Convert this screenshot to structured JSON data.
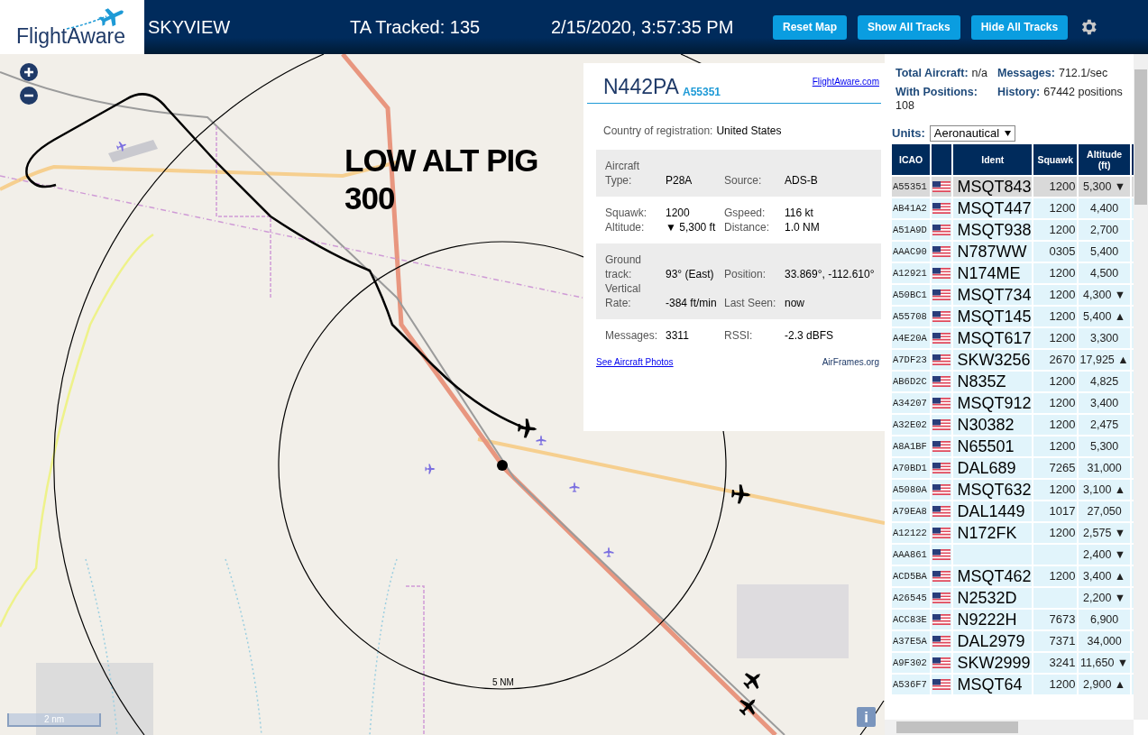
{
  "header": {
    "logo": "FlightAware",
    "title": "SKYVIEW",
    "tracked": "TA Tracked: 135",
    "datetime": "2/15/2020, 3:57:35 PM",
    "buttons": [
      "Reset Map",
      "Show All Tracks",
      "Hide All Tracks"
    ]
  },
  "map": {
    "annotation": "LOW ALT PIG\n300",
    "range_label": "5 NM",
    "scale_label": "2 nm",
    "info_button": "i"
  },
  "popup": {
    "registration": "N442PA",
    "icao": "A55351",
    "site_link": "FlightAware.com",
    "country_label": "Country of registration:",
    "country": "United States",
    "sections": [
      {
        "shaded": true,
        "fields": [
          {
            "label": "Aircraft Type:",
            "value": "P28A"
          },
          {
            "label": "Source:",
            "value": "ADS-B"
          }
        ]
      },
      {
        "shaded": false,
        "fields": [
          {
            "label": "Squawk:",
            "value": "1200"
          },
          {
            "label": "Gspeed:",
            "value": "116 kt"
          },
          {
            "label": "Altitude:",
            "value": "▼ 5,300 ft"
          },
          {
            "label": "Distance:",
            "value": "1.0 NM"
          }
        ]
      },
      {
        "shaded": true,
        "fields": [
          {
            "label": "Ground track:",
            "value": "93° (East)"
          },
          {
            "label": "Position:",
            "value": "33.869°, -112.610°"
          },
          {
            "label": "Vertical Rate:",
            "value": "-384 ft/min"
          },
          {
            "label": "Last Seen:",
            "value": "now"
          }
        ]
      },
      {
        "shaded": false,
        "fields": [
          {
            "label": "Messages:",
            "value": "3311"
          },
          {
            "label": "RSSI:",
            "value": "-2.3 dBFS"
          }
        ]
      }
    ],
    "photos_link": "See Aircraft Photos",
    "airframes_link": "AirFrames.org"
  },
  "stats": [
    {
      "label": "Total Aircraft:",
      "value": "n/a"
    },
    {
      "label": "Messages:",
      "value": "712.1/sec"
    },
    {
      "label": "With Positions:",
      "value": "108"
    },
    {
      "label": "History:",
      "value": "67442 positions"
    }
  ],
  "units": {
    "label": "Units:",
    "value": "Aeronautical"
  },
  "table": {
    "columns": [
      {
        "kind": "text",
        "label": "ICAO"
      },
      {
        "kind": "flag"
      },
      {
        "kind": "text",
        "label": "Ident"
      },
      {
        "kind": "text",
        "label": "Squawk"
      },
      {
        "kind": "text",
        "label": "Altitude (ft)"
      },
      {
        "kind": "cut"
      }
    ],
    "rows": [
      {
        "icao": "A55351",
        "ident": "MSQT843",
        "squawk": "1200",
        "altitude": "5,300 ▼",
        "selected": true
      },
      {
        "icao": "AB41A2",
        "ident": "MSQT447",
        "squawk": "1200",
        "altitude": "4,400",
        "selected": false
      },
      {
        "icao": "A51A9D",
        "ident": "MSQT938",
        "squawk": "1200",
        "altitude": "2,700",
        "selected": false
      },
      {
        "icao": "AAAC90",
        "ident": "N787WW",
        "squawk": "0305",
        "altitude": "5,400",
        "selected": false
      },
      {
        "icao": "A12921",
        "ident": "N174ME",
        "squawk": "1200",
        "altitude": "4,500",
        "selected": false
      },
      {
        "icao": "A50BC1",
        "ident": "MSQT734",
        "squawk": "1200",
        "altitude": "4,300 ▼",
        "selected": false
      },
      {
        "icao": "A55708",
        "ident": "MSQT145",
        "squawk": "1200",
        "altitude": "5,400 ▲",
        "selected": false
      },
      {
        "icao": "A4E20A",
        "ident": "MSQT617",
        "squawk": "1200",
        "altitude": "3,300",
        "selected": false
      },
      {
        "icao": "A7DF23",
        "ident": "SKW3256",
        "squawk": "2670",
        "altitude": "17,925 ▲",
        "selected": false
      },
      {
        "icao": "AB6D2C",
        "ident": "N835Z",
        "squawk": "1200",
        "altitude": "4,825",
        "selected": false
      },
      {
        "icao": "A34207",
        "ident": "MSQT912",
        "squawk": "1200",
        "altitude": "3,400",
        "selected": false
      },
      {
        "icao": "A32E02",
        "ident": "N30382",
        "squawk": "1200",
        "altitude": "2,475",
        "selected": false
      },
      {
        "icao": "A8A1BF",
        "ident": "N65501",
        "squawk": "1200",
        "altitude": "5,300",
        "selected": false
      },
      {
        "icao": "A70BD1",
        "ident": "DAL689",
        "squawk": "7265",
        "altitude": "31,000",
        "selected": false
      },
      {
        "icao": "A5080A",
        "ident": "MSQT632",
        "squawk": "1200",
        "altitude": "3,100 ▲",
        "selected": false
      },
      {
        "icao": "A79EA8",
        "ident": "DAL1449",
        "squawk": "1017",
        "altitude": "27,050",
        "selected": false
      },
      {
        "icao": "A12122",
        "ident": "N172FK",
        "squawk": "1200",
        "altitude": "2,575 ▼",
        "selected": false
      },
      {
        "icao": "AAA861",
        "altitude": "2,400 ▼",
        "selected": false
      },
      {
        "icao": "ACD5BA",
        "ident": "MSQT462",
        "squawk": "1200",
        "altitude": "3,400 ▲",
        "selected": false
      },
      {
        "icao": "A26545",
        "ident": "N2532D",
        "altitude": "2,200 ▼",
        "selected": false
      },
      {
        "icao": "ACC83E",
        "ident": "N9222H",
        "squawk": "7673",
        "altitude": "6,900",
        "selected": false
      },
      {
        "icao": "A37E5A",
        "ident": "DAL2979",
        "squawk": "7371",
        "altitude": "34,000",
        "selected": false
      },
      {
        "icao": "A9F302",
        "ident": "SKW2999",
        "squawk": "3241",
        "altitude": "11,650 ▼",
        "selected": false
      },
      {
        "icao": "A536F7",
        "ident": "MSQT64",
        "squawk": "1200",
        "altitude": "2,900 ▲",
        "selected": false
      }
    ]
  }
}
